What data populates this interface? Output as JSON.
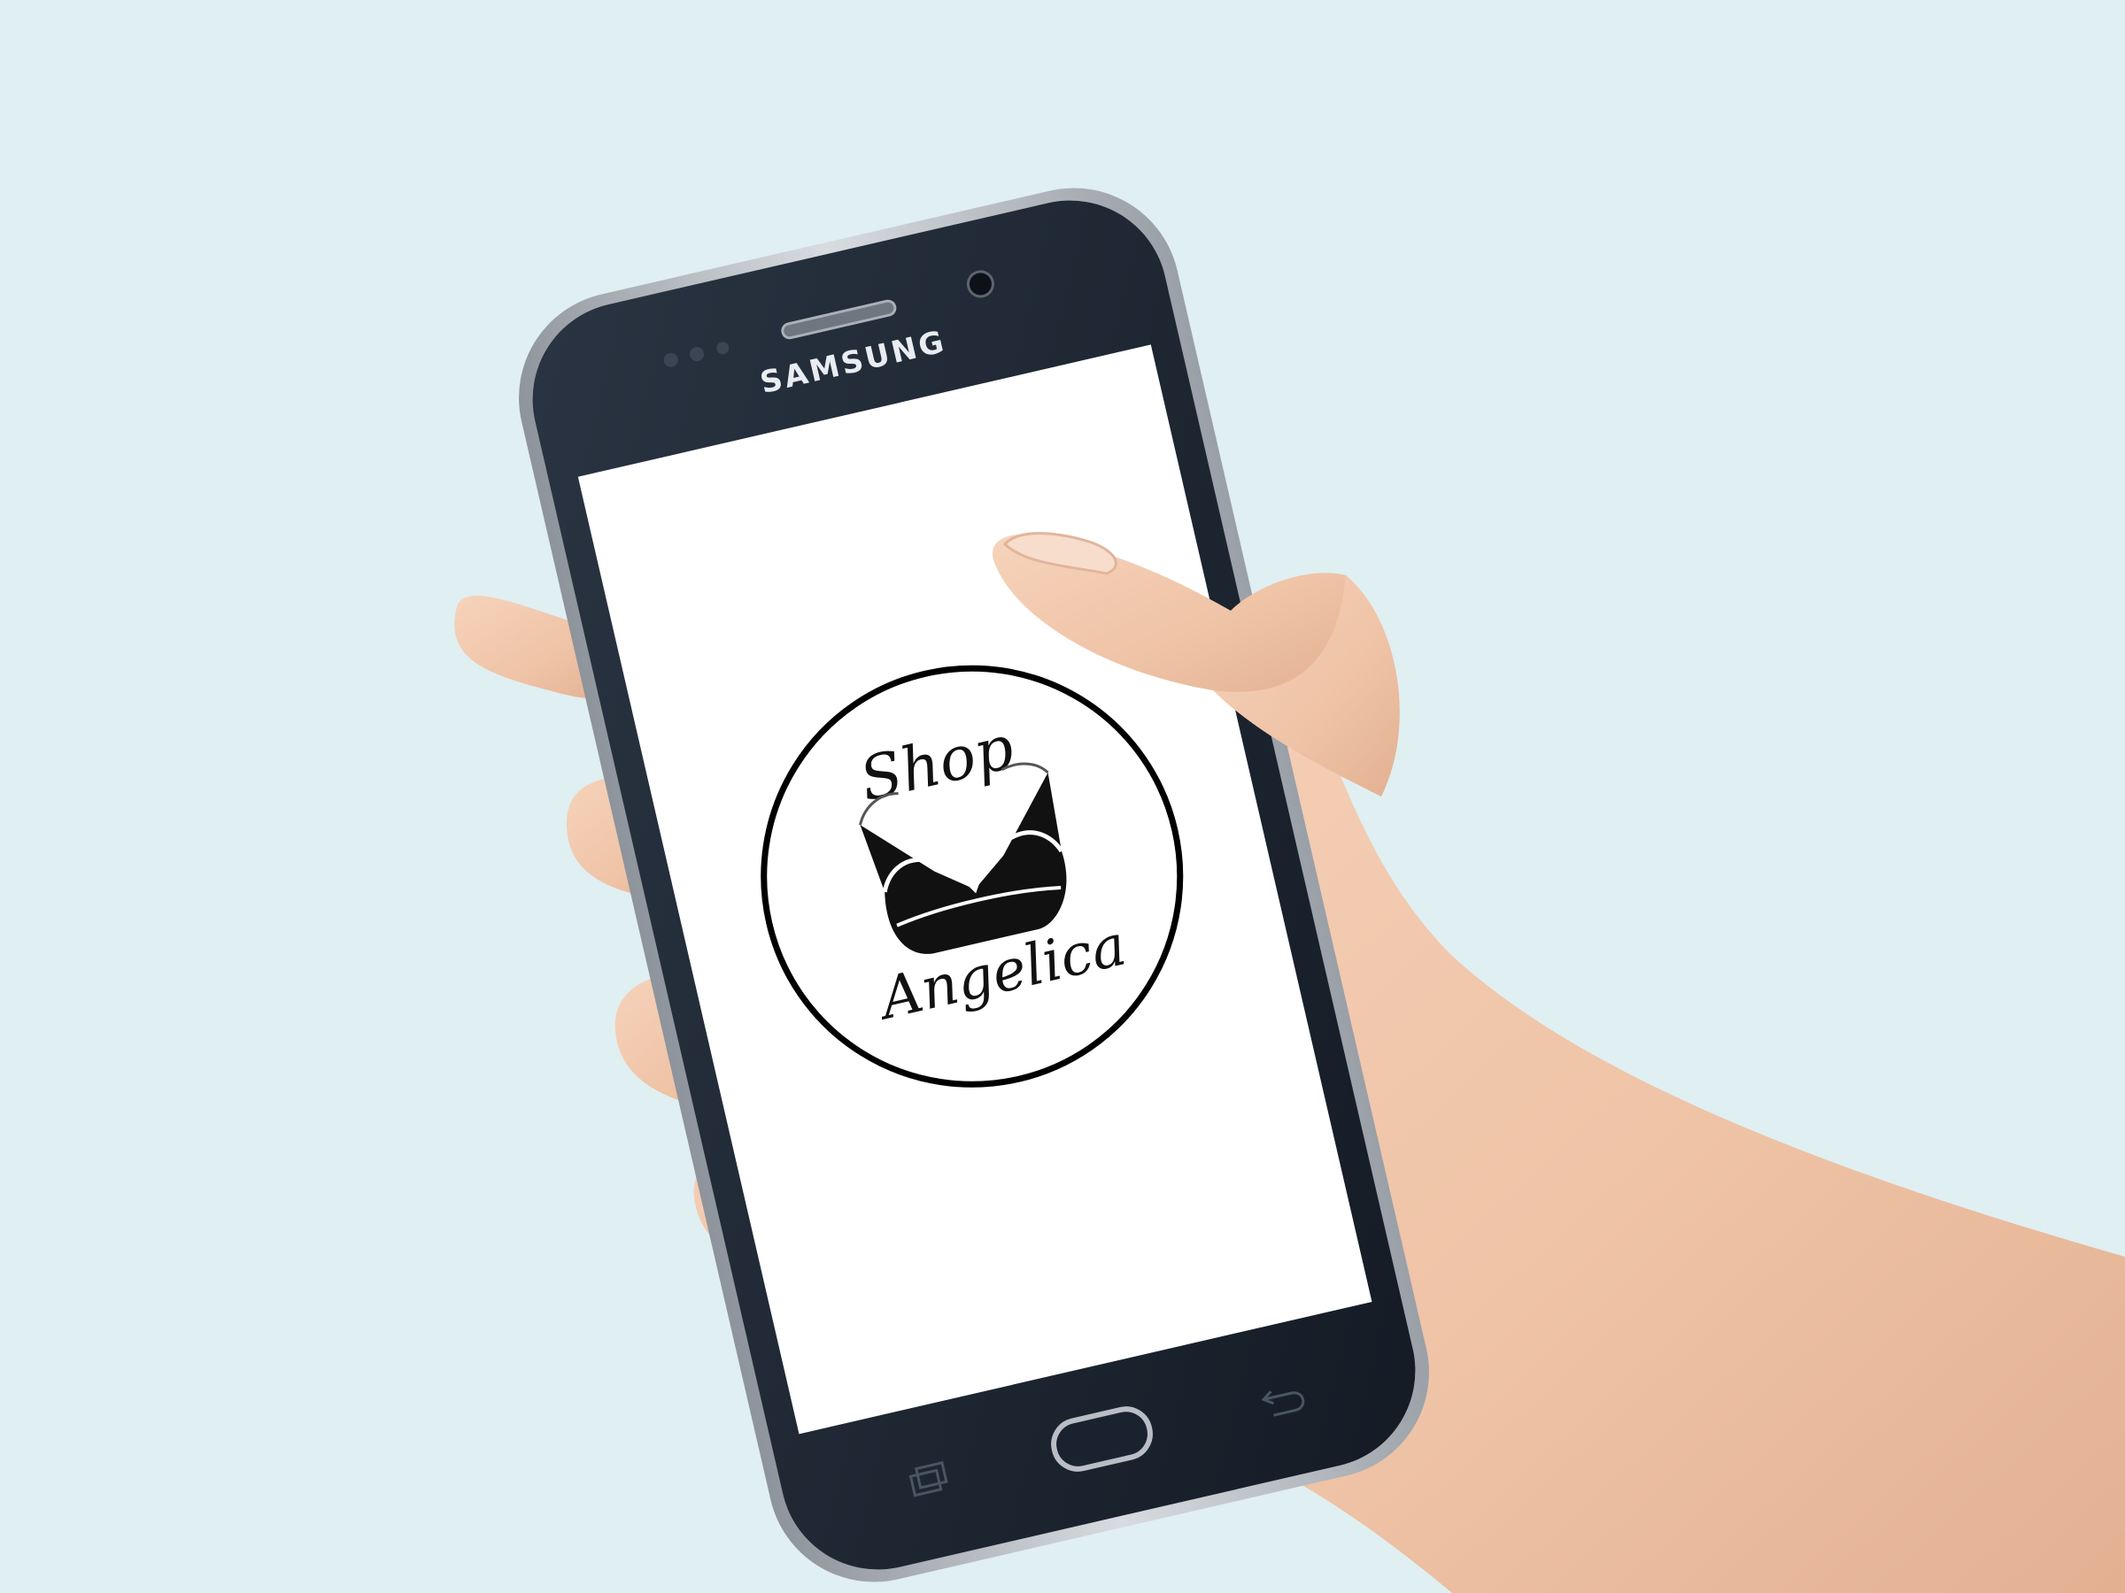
{
  "scene": {
    "background_color": "#e0eff1",
    "skin_color": "#f2c8ad",
    "phone_body_color": "#1a2330",
    "phone_frame_color": "#b9bec4",
    "screen_color": "#ffffff"
  },
  "phone": {
    "brand": "SAMSUNG",
    "icons": [
      "earpiece-grille",
      "front-camera-icon",
      "sensor-dots",
      "home-button",
      "recent-apps-icon",
      "back-arrow-icon"
    ]
  },
  "screen": {
    "logo": {
      "line1": "Shop",
      "line2": "Angelica",
      "emblem": "bra-icon",
      "ring_color": "#000000"
    }
  }
}
